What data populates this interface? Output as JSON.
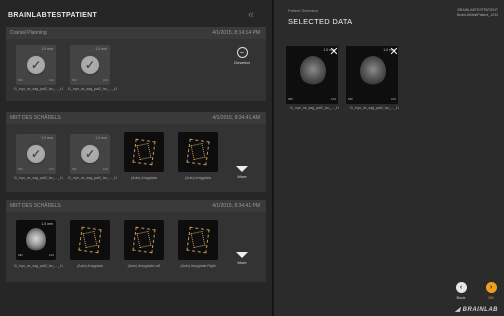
{
  "left": {
    "patient_name": "BRAINLABTESTPATIENT",
    "collapse_icon": "double-chevron-left-icon",
    "sections": [
      {
        "name": "Cranial Planning",
        "date": "4/1/2015, 8:14:14 PM",
        "side_button": "Deselect",
        "items": [
          {
            "mm": "1.0 mm",
            "left": "MR",
            "right": "102",
            "caption": "t1_mpr_ns_sag_pat2_iso_..._t1"
          },
          {
            "mm": "1.0 mm",
            "left": "MR",
            "right": "102",
            "caption": "t1_mpr_ns_sag_pat2_iso_..._t1"
          }
        ]
      },
      {
        "name": "MRT DES SCHÄDELS",
        "date": "4/1/2015, 8:34:41 AM",
        "side_button": "More",
        "items": [
          {
            "mm": "1.0 mm",
            "left": "MR",
            "right": "102",
            "caption": "t1_mpr_ns_sag_pat2_iso_..._t1"
          },
          {
            "mm": "1.0 mm",
            "left": "MR",
            "right": "102",
            "caption": "t1_mpr_ns_sag_pat2_iso_..._t1"
          },
          {
            "caption": "(Auto) Amygdala"
          },
          {
            "caption": "(Auto) Amygdala"
          }
        ]
      },
      {
        "name": "MRT DES SCHÄDELS",
        "date": "4/1/2015, 8:34:41 PM",
        "side_button": "More",
        "items": [
          {
            "mm": "1.0 mm",
            "left": "MR",
            "right": "102",
            "caption": "t1_mpr_ns_sag_pat2_iso_..._t1"
          },
          {
            "caption": "(Auto) Amygdala"
          },
          {
            "caption": "(Auto) Amygdala Left"
          },
          {
            "caption": "(Auto) Amygdala Right"
          }
        ]
      }
    ]
  },
  "right": {
    "breadcrumb": "Patient Selection",
    "title": "SELECTED DATA",
    "patient_id_line1": "BRAINLABTESTPATIENT",
    "patient_id_line2": "BrainLABtestPatient_1234",
    "selected": [
      {
        "mm": "1.0 mm",
        "left": "MR",
        "right": "102",
        "caption": "t1_mpr_ns_sag_pat2_iso_..._t1"
      },
      {
        "mm": "1.0 mm",
        "left": "MR",
        "right": "102",
        "caption": "t1_mpr_ns_sag_pat2_iso_..._t1"
      }
    ],
    "back_label": "Back",
    "ok_label": "OK",
    "logo": "BRAINLAB"
  },
  "colors": {
    "ok_button": "#f0a020",
    "object_outline": "#c49a5a"
  }
}
